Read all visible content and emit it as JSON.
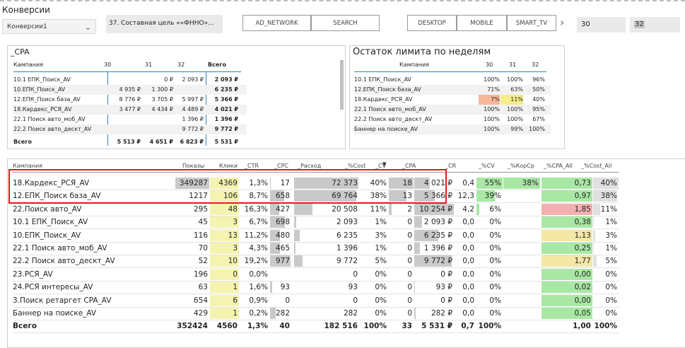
{
  "header": {
    "title": "Конверсии",
    "conversion_dropdown": "Конверсии1",
    "goal_label": "37. Составная цель ««ФННО»...",
    "buttons": [
      "AD_NETWORK",
      "SEARCH",
      "DESKTOP",
      "MOBILE",
      "SMART_TV"
    ],
    "range_from": "30",
    "range_to": "32",
    "icons": {
      "dropdown": "chevron-down-icon",
      "next": "chevron-right-icon"
    }
  },
  "cpa_panel": {
    "title": "_CPA",
    "columns": [
      "Кампания",
      "30",
      "31",
      "32",
      "Всего"
    ],
    "rows": [
      [
        "10.1 ЕПК_Поиск_AV",
        "",
        "0 ₽",
        "2 093 ₽",
        "2 093 ₽"
      ],
      [
        "10.ЕПК_Поиск_AV",
        "4 935 ₽",
        "1 300 ₽",
        "",
        "6 235 ₽"
      ],
      [
        "12.ЕПК_Поиск база_AV",
        "8 776 ₽",
        "3 705 ₽",
        "5 997 ₽",
        "5 366 ₽"
      ],
      [
        "18.Кардекс_РСЯ_AV",
        "3 477 ₽",
        "4 434 ₽",
        "4 489 ₽",
        "4 021 ₽"
      ],
      [
        "22.1 Поиск авто_моб_AV",
        "",
        "",
        "1 396 ₽",
        "1 396 ₽"
      ],
      [
        "22.2 Поиск авто_дескт_AV",
        "",
        "",
        "9 772 ₽",
        "9 772 ₽"
      ]
    ],
    "total": [
      "Всего",
      "5 513 ₽",
      "4 651 ₽",
      "6 823 ₽",
      "5 531 ₽"
    ]
  },
  "limit_panel": {
    "title": "Остаток лимита по неделям",
    "columns": [
      "Кампания",
      "30",
      "31",
      "32"
    ],
    "rows": [
      [
        "10.1 ЕПК_Поиск_AV",
        "100%",
        "100%",
        "96%"
      ],
      [
        "12.ЕПК_Поиск база_AV",
        "71%",
        "63%",
        "50%"
      ],
      [
        "18.Кардекс_РСЯ_AV",
        "7%",
        "11%",
        "40%"
      ],
      [
        "22.1 Поиск авто_моб_AV",
        "100%",
        "100%",
        "95%"
      ],
      [
        "22.2 Поиск авто_дескт_AV",
        "100%",
        "100%",
        "67%"
      ],
      [
        "Баннер на поиске_AV",
        "100%",
        "99%",
        "100%"
      ]
    ],
    "highlight_colors": {
      "low": "#f7b79a",
      "mid": "#f5ec8a"
    }
  },
  "main_table": {
    "columns": [
      "Кампания",
      "Показы",
      "Клики",
      "_CTR",
      "_CPC",
      "_Расход",
      "_%Cost",
      "_CV",
      "_CPA",
      "_CR",
      "_%CV",
      "_%КорСр",
      "_%CPA_All",
      "_%Cost_All"
    ],
    "rows": [
      [
        "18.Кардекс_РСЯ_AV",
        "349287",
        "4369",
        "1,3%",
        "17",
        "72 373",
        "40%",
        "18",
        "4 021 ₽",
        "0,4",
        "55%",
        "38%",
        "0,73",
        "40%"
      ],
      [
        "12.ЕПК_Поиск база_AV",
        "1217",
        "106",
        "8,7%",
        "658",
        "69 764",
        "38%",
        "13",
        "5 366 ₽",
        "12,3",
        "39%",
        "",
        "0,97",
        "38%"
      ],
      [
        "22.Поиск авто_AV",
        "295",
        "48",
        "16,3%",
        "427",
        "20 508",
        "11%",
        "2",
        "10 254 ₽",
        "4,2",
        "6%",
        "",
        "1,85",
        "11%"
      ],
      [
        "10.1 ЕПК_Поиск_AV",
        "45",
        "3",
        "6,7%",
        "698",
        "2 093",
        "1%",
        "0",
        "2 093 ₽",
        "0,0",
        "0%",
        "",
        "0,38",
        "1%"
      ],
      [
        "10.ЕПК_Поиск_AV",
        "116",
        "13",
        "11,2%",
        "480",
        "6 235",
        "3%",
        "0",
        "6 235 ₽",
        "0,0",
        "0%",
        "",
        "1,13",
        "3%"
      ],
      [
        "22.1 Поиск авто_моб_AV",
        "70",
        "3",
        "4,3%",
        "465",
        "1 396",
        "1%",
        "0",
        "1 396 ₽",
        "0,0",
        "0%",
        "",
        "0,25",
        "1%"
      ],
      [
        "22.2 Поиск авто_дескт_AV",
        "52",
        "10",
        "19,2%",
        "977",
        "9 772",
        "5%",
        "0",
        "9 772 ₽",
        "0,0",
        "0%",
        "",
        "1,77",
        "5%"
      ],
      [
        "23.РСЯ_AV",
        "196",
        "0",
        "0,0%",
        "",
        "0",
        "0%",
        "0",
        "0 ₽",
        "0,0",
        "0%",
        "",
        "0,00",
        "0%"
      ],
      [
        "24.РСЯ интересы_AV",
        "63",
        "1",
        "1,6%",
        "93",
        "93",
        "0%",
        "0",
        "93 ₽",
        "0,0",
        "0%",
        "",
        "0,02",
        "0%"
      ],
      [
        "3.Поиск ретаргет CPA_AV",
        "654",
        "6",
        "0,9%",
        "0",
        "0",
        "0%",
        "0",
        "0 ₽",
        "0,0",
        "0%",
        "",
        "0,00",
        "0%"
      ],
      [
        "Баннер на поиске_AV",
        "429",
        "1",
        "0,2%",
        "282",
        "282",
        "0%",
        "0",
        "282 ₽",
        "0,0",
        "0%",
        "",
        "0,05",
        "0%"
      ]
    ],
    "total": [
      "Всего",
      "352424",
      "4560",
      "1,3%",
      "40",
      "182 516",
      "100%",
      "33",
      "5 531 ₽",
      "0,7",
      "100%",
      "",
      "1,00",
      "100%"
    ],
    "sort_indicator_icon": "sort-desc-icon"
  }
}
